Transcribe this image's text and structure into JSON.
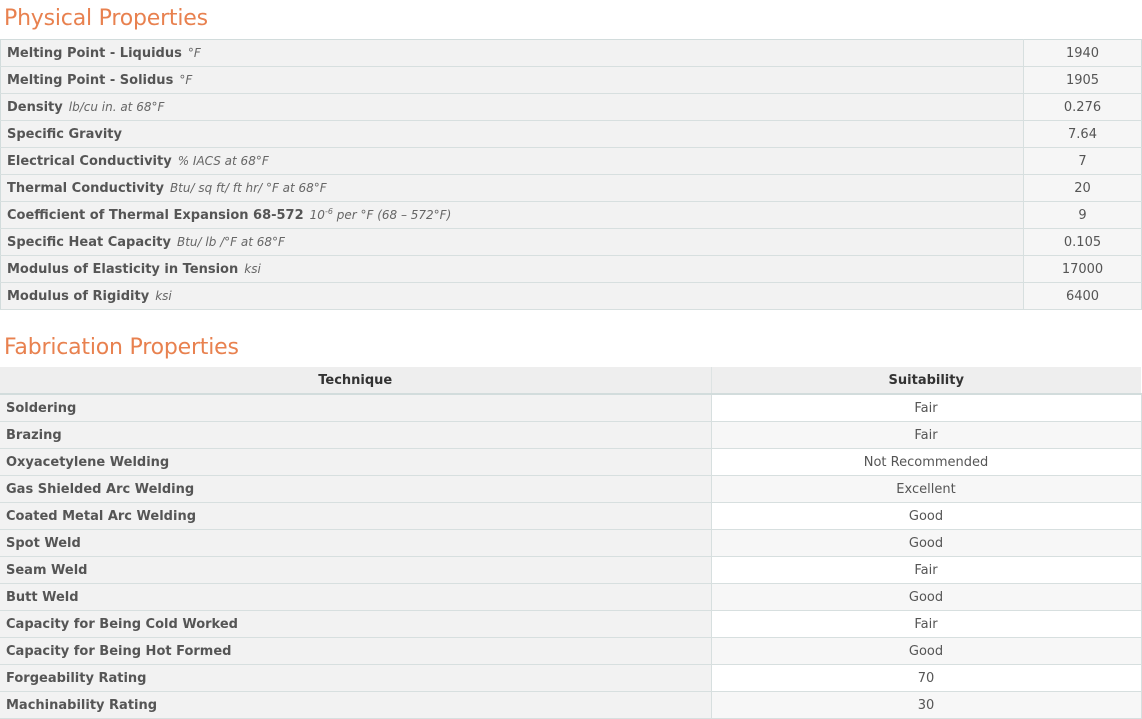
{
  "physical": {
    "title": "Physical Properties",
    "rows": [
      {
        "name": "Melting Point - Liquidus",
        "unit": "°F",
        "value": "1940"
      },
      {
        "name": "Melting Point - Solidus",
        "unit": "°F",
        "value": "1905"
      },
      {
        "name": "Density",
        "unit": "lb/cu in. at 68°F",
        "value": "0.276"
      },
      {
        "name": "Specific Gravity",
        "unit": "",
        "value": "7.64"
      },
      {
        "name": "Electrical Conductivity",
        "unit": "% IACS at 68°F",
        "value": "7"
      },
      {
        "name": "Thermal Conductivity",
        "unit": "Btu/ sq ft/ ft hr/ °F at 68°F",
        "value": "20"
      },
      {
        "name": "Coefficient of Thermal Expansion 68-572",
        "unit_prefix": "10",
        "unit_sup": "-6",
        "unit_suffix": " per °F (68 – 572°F)",
        "value": "9"
      },
      {
        "name": "Specific Heat Capacity",
        "unit": "Btu/ lb /°F at 68°F",
        "value": "0.105"
      },
      {
        "name": "Modulus of Elasticity in Tension",
        "unit": "ksi",
        "value": "17000"
      },
      {
        "name": "Modulus of Rigidity",
        "unit": "ksi",
        "value": "6400"
      }
    ]
  },
  "fabrication": {
    "title": "Fabrication Properties",
    "headers": {
      "technique": "Technique",
      "suitability": "Suitability"
    },
    "rows": [
      {
        "technique": "Soldering",
        "suitability": "Fair"
      },
      {
        "technique": "Brazing",
        "suitability": "Fair"
      },
      {
        "technique": "Oxyacetylene Welding",
        "suitability": "Not Recommended"
      },
      {
        "technique": "Gas Shielded Arc Welding",
        "suitability": "Excellent"
      },
      {
        "technique": "Coated Metal Arc Welding",
        "suitability": "Good"
      },
      {
        "technique": "Spot Weld",
        "suitability": "Good"
      },
      {
        "technique": "Seam Weld",
        "suitability": "Fair"
      },
      {
        "technique": "Butt Weld",
        "suitability": "Good"
      },
      {
        "technique": "Capacity for Being Cold Worked",
        "suitability": "Fair"
      },
      {
        "technique": "Capacity for Being Hot Formed",
        "suitability": "Good"
      },
      {
        "technique": "Forgeability Rating",
        "suitability": "70"
      },
      {
        "technique": "Machinability Rating",
        "suitability": "30"
      }
    ]
  }
}
